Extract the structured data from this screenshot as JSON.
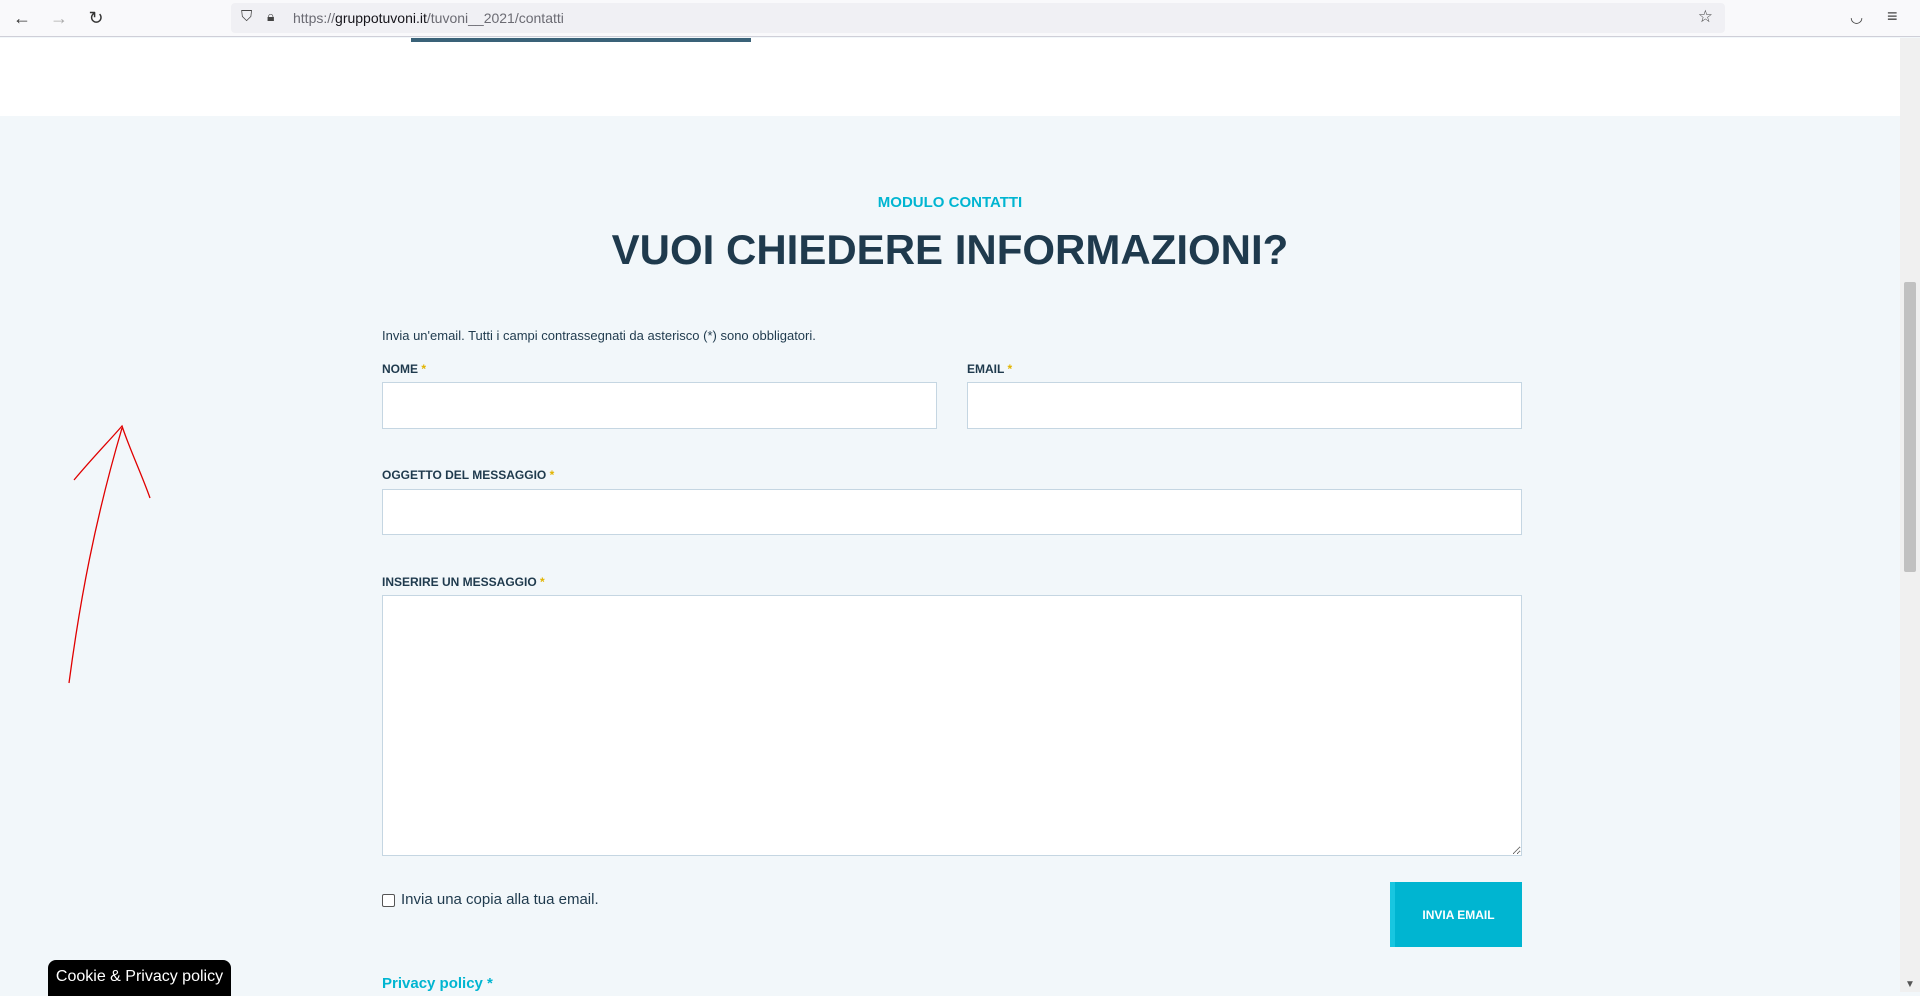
{
  "browser": {
    "url_prefix": "https://",
    "url_domain": "gruppotuvoni.it",
    "url_path": "/tuvoni__2021/contatti"
  },
  "section": {
    "eyebrow": "MODULO CONTATTI",
    "title": "VUOI CHIEDERE INFORMAZIONI?"
  },
  "form": {
    "intro": "Invia un'email. Tutti i campi contrassegnati da asterisco (*) sono obbligatori.",
    "required_mark": "*",
    "name_label": "NOME",
    "email_label": "EMAIL",
    "subject_label": "OGGETTO DEL MESSAGGIO",
    "message_label": "INSERIRE UN MESSAGGIO",
    "name_value": "",
    "email_value": "",
    "subject_value": "",
    "message_value": "",
    "copy_label": "Invia una copia alla tua email.",
    "copy_checked": false,
    "submit_label": "INVIA EMAIL",
    "privacy_label": "Privacy policy *"
  },
  "cookie_badge": "Cookie & Privacy policy",
  "colors": {
    "accent": "#00b5d1",
    "heading": "#1f3a4d",
    "background": "#f2f7fa",
    "annotation": "#e00000"
  }
}
